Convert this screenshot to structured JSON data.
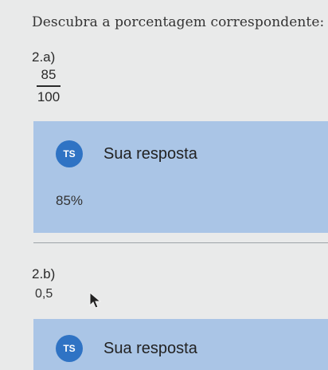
{
  "instruction": "Descubra a porcentagem correspondente:",
  "questions": [
    {
      "label": "2.a)",
      "numerator": "85",
      "denominator": "100",
      "answer": {
        "avatar_initials": "TS",
        "title": "Sua resposta",
        "text": "85%"
      }
    },
    {
      "label": "2.b)",
      "value": "0,5",
      "answer": {
        "avatar_initials": "TS",
        "title": "Sua resposta"
      }
    }
  ],
  "colors": {
    "card_background": "#aac5e6",
    "avatar": "#2f73c4",
    "page_background": "#e9eaea"
  },
  "icons": [
    "mouse-pointer-icon"
  ]
}
